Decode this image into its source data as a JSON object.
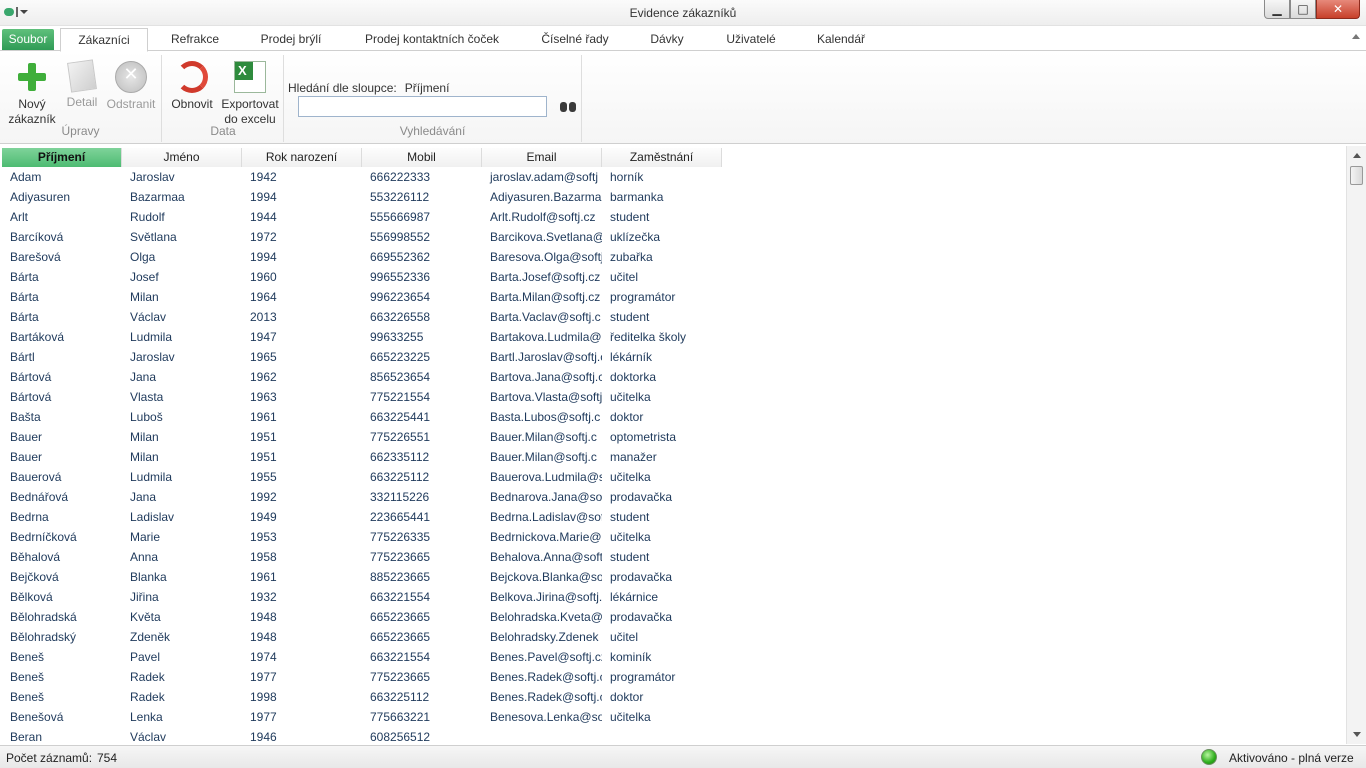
{
  "window": {
    "title": "Evidence zákazníků",
    "minimize_glyph": "▁",
    "maximize_glyph": "□",
    "close_glyph": "✕"
  },
  "tabs": [
    {
      "label": "Soubor"
    },
    {
      "label": "Zákazníci"
    },
    {
      "label": "Refrakce"
    },
    {
      "label": "Prodej brýlí"
    },
    {
      "label": "Prodej kontaktních čoček"
    },
    {
      "label": "Číselné řady"
    },
    {
      "label": "Dávky"
    },
    {
      "label": "Uživatelé"
    },
    {
      "label": "Kalendář"
    }
  ],
  "ribbon": {
    "groups": {
      "edits": "Úpravy",
      "data": "Data",
      "search": "Vyhledávání"
    },
    "new_customer": {
      "line1": "Nový",
      "line2": "zákazník",
      "icon": "plus-icon"
    },
    "detail": {
      "label": "Detail",
      "icon": "document-icon"
    },
    "remove": {
      "label": "Odstranit",
      "icon": "remove-icon",
      "glyph": "✕"
    },
    "refresh": {
      "label": "Obnovit",
      "icon": "refresh-icon"
    },
    "export": {
      "line1": "Exportovat",
      "line2": "do excelu",
      "icon": "excel-icon",
      "glyph": "X"
    },
    "search": {
      "label": "Hledání dle sloupce:",
      "column": "Příjmení",
      "value": "",
      "icon": "binoculars-icon"
    }
  },
  "grid": {
    "columns": [
      "Příjmení",
      "Jméno",
      "Rok narození",
      "Mobil",
      "Email",
      "Zaměstnání"
    ],
    "sorted_column": "Příjmení",
    "rows": [
      [
        "Adam",
        "Jaroslav",
        "1942",
        "666222333",
        "jaroslav.adam@softj",
        "horník"
      ],
      [
        "Adiyasuren",
        "Bazarmaa",
        "1994",
        "553226112",
        "Adiyasuren.Bazarma",
        "barmanka"
      ],
      [
        "Arlt",
        "Rudolf",
        "1944",
        "555666987",
        "Arlt.Rudolf@softj.cz",
        "student"
      ],
      [
        "Barcíková",
        "Světlana",
        "1972",
        "556998552",
        "Barcikova.Svetlana@",
        "uklízečka"
      ],
      [
        "Barešová",
        "Olga",
        "1994",
        "669552362",
        "Baresova.Olga@softj",
        "zubařka"
      ],
      [
        "Bárta",
        "Josef",
        "1960",
        "996552336",
        "Barta.Josef@softj.cz",
        "učitel"
      ],
      [
        "Bárta",
        "Milan",
        "1964",
        "996223654",
        "Barta.Milan@softj.cz",
        "programátor"
      ],
      [
        "Bárta",
        "Václav",
        "2013",
        "663226558",
        "Barta.Vaclav@softj.c",
        "student"
      ],
      [
        "Bartáková",
        "Ludmila",
        "1947",
        "99633255",
        "Bartakova.Ludmila@",
        "ředitelka školy"
      ],
      [
        "Bártl",
        "Jaroslav",
        "1965",
        "665223225",
        "Bartl.Jaroslav@softj.c",
        "lékárník"
      ],
      [
        "Bártová",
        "Jana",
        "1962",
        "856523654",
        "Bartova.Jana@softj.c",
        "doktorka"
      ],
      [
        "Bártová",
        "Vlasta",
        "1963",
        "775221554",
        "Bartova.Vlasta@softj",
        "učitelka"
      ],
      [
        "Bašta",
        "Luboš",
        "1961",
        "663225441",
        "Basta.Lubos@softj.c",
        "doktor"
      ],
      [
        "Bauer",
        "Milan",
        "1951",
        "775226551",
        "Bauer.Milan@softj.c",
        "optometrista"
      ],
      [
        "Bauer",
        "Milan",
        "1951",
        "662335112",
        "Bauer.Milan@softj.c",
        "manažer"
      ],
      [
        "Bauerová",
        "Ludmila",
        "1955",
        "663225112",
        "Bauerova.Ludmila@s",
        "učitelka"
      ],
      [
        "Bednářová",
        "Jana",
        "1992",
        "332115226",
        "Bednarova.Jana@sof",
        "prodavačka"
      ],
      [
        "Bedrna",
        "Ladislav",
        "1949",
        "223665441",
        "Bedrna.Ladislav@sof",
        "student"
      ],
      [
        "Bedrníčková",
        "Marie",
        "1953",
        "775226335",
        "Bedrnickova.Marie@",
        "učitelka"
      ],
      [
        "Běhalová",
        "Anna",
        "1958",
        "775223665",
        "Behalova.Anna@soft",
        "student"
      ],
      [
        "Bejčková",
        "Blanka",
        "1961",
        "885223665",
        "Bejckova.Blanka@so",
        "prodavačka"
      ],
      [
        "Bělková",
        "Jiřina",
        "1932",
        "663221554",
        "Belkova.Jirina@softj.",
        "lékárnice"
      ],
      [
        "Bělohradská",
        "Květa",
        "1948",
        "665223665",
        "Belohradska.Kveta@",
        "prodavačka"
      ],
      [
        "Bělohradský",
        "Zdeněk",
        "1948",
        "665223665",
        "Belohradsky.Zdenek",
        "učitel"
      ],
      [
        "Beneš",
        "Pavel",
        "1974",
        "663221554",
        "Benes.Pavel@softj.cz",
        "kominík"
      ],
      [
        "Beneš",
        "Radek",
        "1977",
        "775223665",
        "Benes.Radek@softj.c",
        "programátor"
      ],
      [
        "Beneš",
        "Radek",
        "1998",
        "663225112",
        "Benes.Radek@softj.c",
        "doktor"
      ],
      [
        "Benešová",
        "Lenka",
        "1977",
        "775663221",
        "Benesova.Lenka@so",
        "učitelka"
      ],
      [
        "Beran",
        "Václav",
        "1946",
        "608256512",
        "",
        ""
      ]
    ]
  },
  "status": {
    "count_label": "Počet záznamů:",
    "count_value": "754",
    "activation": "Aktivováno - plná verze",
    "activation_color": "#2eae1c"
  }
}
